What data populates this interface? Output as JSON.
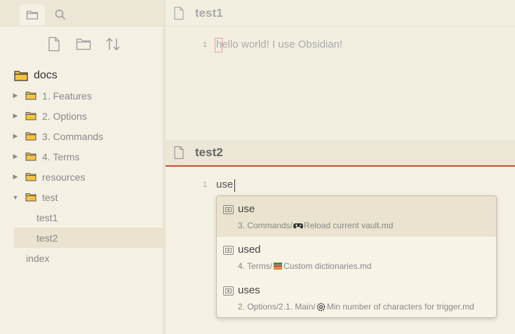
{
  "sidebar": {
    "tabs": [
      {
        "icon": "folder-icon",
        "active": true
      },
      {
        "icon": "search-icon",
        "active": false
      }
    ],
    "toolbar": [
      {
        "icon": "new-file-icon"
      },
      {
        "icon": "new-folder-icon"
      },
      {
        "icon": "sort-icon"
      }
    ],
    "root": "docs",
    "folders": [
      {
        "label": "1. Features",
        "expanded": false
      },
      {
        "label": "2. Options",
        "expanded": false
      },
      {
        "label": "3. Commands",
        "expanded": false
      },
      {
        "label": "4. Terms",
        "expanded": false
      },
      {
        "label": "resources",
        "expanded": false
      },
      {
        "label": "test",
        "expanded": true
      }
    ],
    "test_files": [
      {
        "label": "test1",
        "selected": false
      },
      {
        "label": "test2",
        "selected": true
      }
    ],
    "root_file": "index"
  },
  "pane1": {
    "title": "test1",
    "line_number": "1",
    "text": "hello world! I use Obsidian!"
  },
  "pane2": {
    "title": "test2",
    "line_number": "1",
    "text": "use"
  },
  "suggestions": [
    {
      "word": "use",
      "path_prefix": "3. Commands/",
      "emoji": "game-controller-icon",
      "path_suffix": "Reload current vault.md",
      "selected": true
    },
    {
      "word": "used",
      "path_prefix": "4. Terms/",
      "emoji": "books-icon",
      "path_suffix": "Custom dictionaries.md",
      "selected": false
    },
    {
      "word": "uses",
      "path_prefix": "2. Options/2.1. Main/",
      "emoji": "gear-icon",
      "path_suffix": "Min number of characters for trigger.md",
      "selected": false
    }
  ],
  "colors": {
    "accent": "#c4512b",
    "folder": "#f5c343"
  }
}
